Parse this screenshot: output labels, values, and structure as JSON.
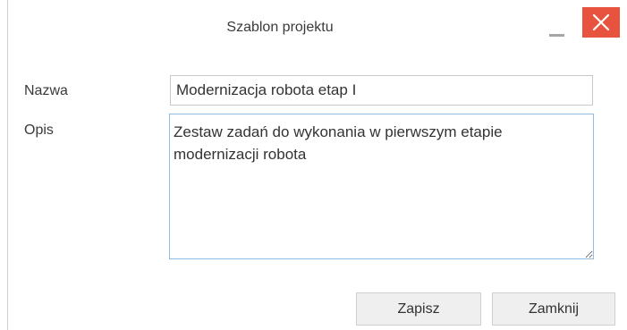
{
  "dialog": {
    "title": "Szablon projektu",
    "minimize_icon": "minimize-icon",
    "close_icon": "close-icon",
    "close_color": "#e8533f"
  },
  "form": {
    "name_label": "Nazwa",
    "name_value": "Modernizacja robota etap I",
    "description_label": "Opis",
    "description_value": "Zestaw zadań do wykonania w pierwszym etapie\nmodernizacji robota"
  },
  "buttons": {
    "save_label": "Zapisz",
    "close_label": "Zamknij"
  }
}
